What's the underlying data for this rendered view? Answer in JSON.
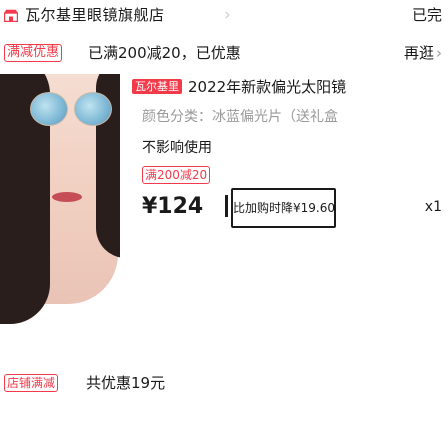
{
  "store": {
    "name": "瓦尔基里眼镜旗舰店",
    "chevron": "›",
    "order_status": "已完"
  },
  "promo": {
    "tag": "满减优惠",
    "text": "已满200减20，已优惠",
    "action": "再逛",
    "action_chevron": "›"
  },
  "product": {
    "brand_badge": "瓦尔基里",
    "title": "2022年新款偏光太阳镜",
    "spec": "颜色分类：冰蓝偏光片（送礼盒",
    "desc": "不影响使用",
    "coupon_tag": "满200减20",
    "price": "¥124",
    "compare_button": "比加购时降¥19.60",
    "quantity": "x1"
  },
  "bottom": {
    "tag": "店铺满减",
    "text": "共优惠19元"
  },
  "colors": {
    "accent_red": "#f23a4a",
    "muted_gray": "#9a9a9a"
  }
}
